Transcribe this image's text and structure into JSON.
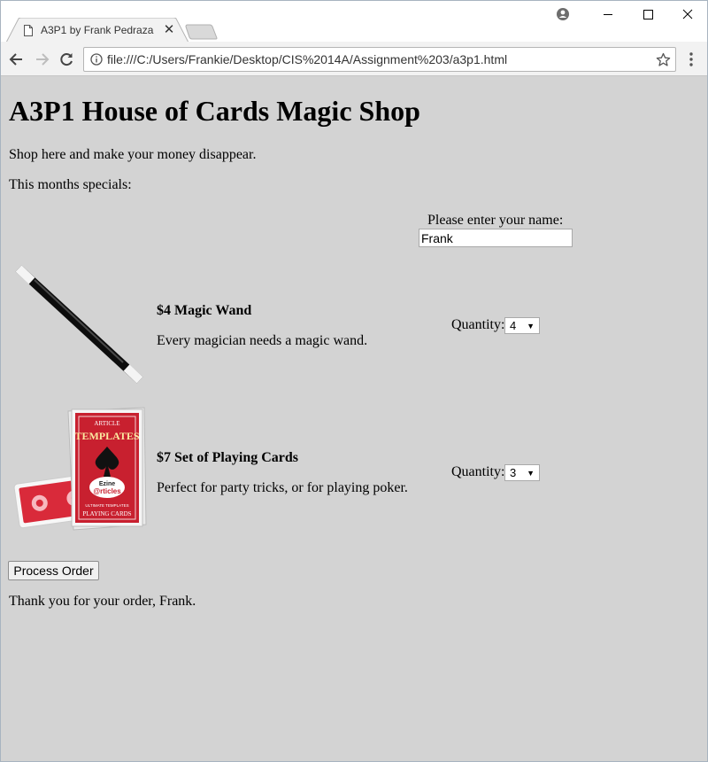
{
  "browser": {
    "tab_title": "A3P1 by Frank Pedraza",
    "url": "file:///C:/Users/Frankie/Desktop/CIS%2014A/Assignment%203/a3p1.html"
  },
  "page": {
    "heading": "A3P1 House of Cards Magic Shop",
    "tagline": "Shop here and make your money disappear.",
    "specials_label": "This months specials:",
    "name_prompt": "Please enter your name:",
    "name_value": "Frank",
    "products": [
      {
        "title": "$4 Magic Wand",
        "description": "Every magician needs a magic wand.",
        "quantity_label": "Quantity:",
        "quantity": "4",
        "image_icon": "magic-wand-image"
      },
      {
        "title": "$7 Set of Playing Cards",
        "description": "Perfect for party tricks, or for playing poker.",
        "quantity_label": "Quantity:",
        "quantity": "3",
        "image_icon": "playing-cards-image"
      }
    ],
    "process_button": "Process Order",
    "thank_you": "Thank you for your order, Frank."
  },
  "card_box_text": {
    "top": "ARTICLE",
    "main": "TEMPLATES",
    "brand1": "Ezine",
    "brand2": "@rticles",
    "bottom1": "ULTIMATE TEMPLATES",
    "bottom2": "PLAYING CARDS"
  },
  "colors": {
    "page_bg": "#d3d3d3",
    "card_red": "#c8202f"
  }
}
